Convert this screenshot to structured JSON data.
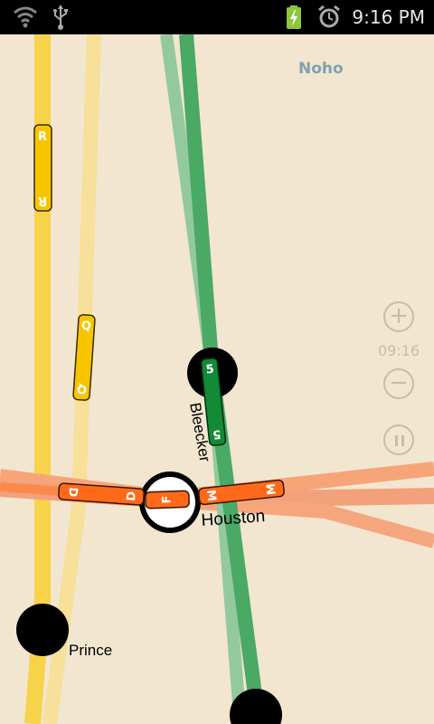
{
  "status_bar": {
    "time": "9:16 PM",
    "icons": [
      "wifi-icon",
      "usb-icon",
      "battery-charging-icon",
      "alarm-clock-icon"
    ]
  },
  "map": {
    "area_label": "Noho",
    "stations": {
      "bleecker": "Bleecker",
      "houston": "Houston",
      "prince": "Prince"
    },
    "trains": [
      {
        "route": "R",
        "color": "#f7c500"
      },
      {
        "route": "Q",
        "color": "#f7c500"
      },
      {
        "route": "5",
        "color": "#1f8f3f"
      },
      {
        "route": "D",
        "color": "#ff6a1a"
      },
      {
        "route": "F",
        "color": "#ff6a1a"
      },
      {
        "route": "M",
        "color": "#ff6a1a"
      }
    ],
    "colors": {
      "background": "#f2e6d0",
      "yellow_line": "#f7d34a",
      "green_line": "#4cae63",
      "orange_line": "#f7934f"
    }
  },
  "controls": {
    "zoom_in": "+",
    "zoom_out": "−",
    "clock": "09:16",
    "pause": "pause-icon"
  }
}
